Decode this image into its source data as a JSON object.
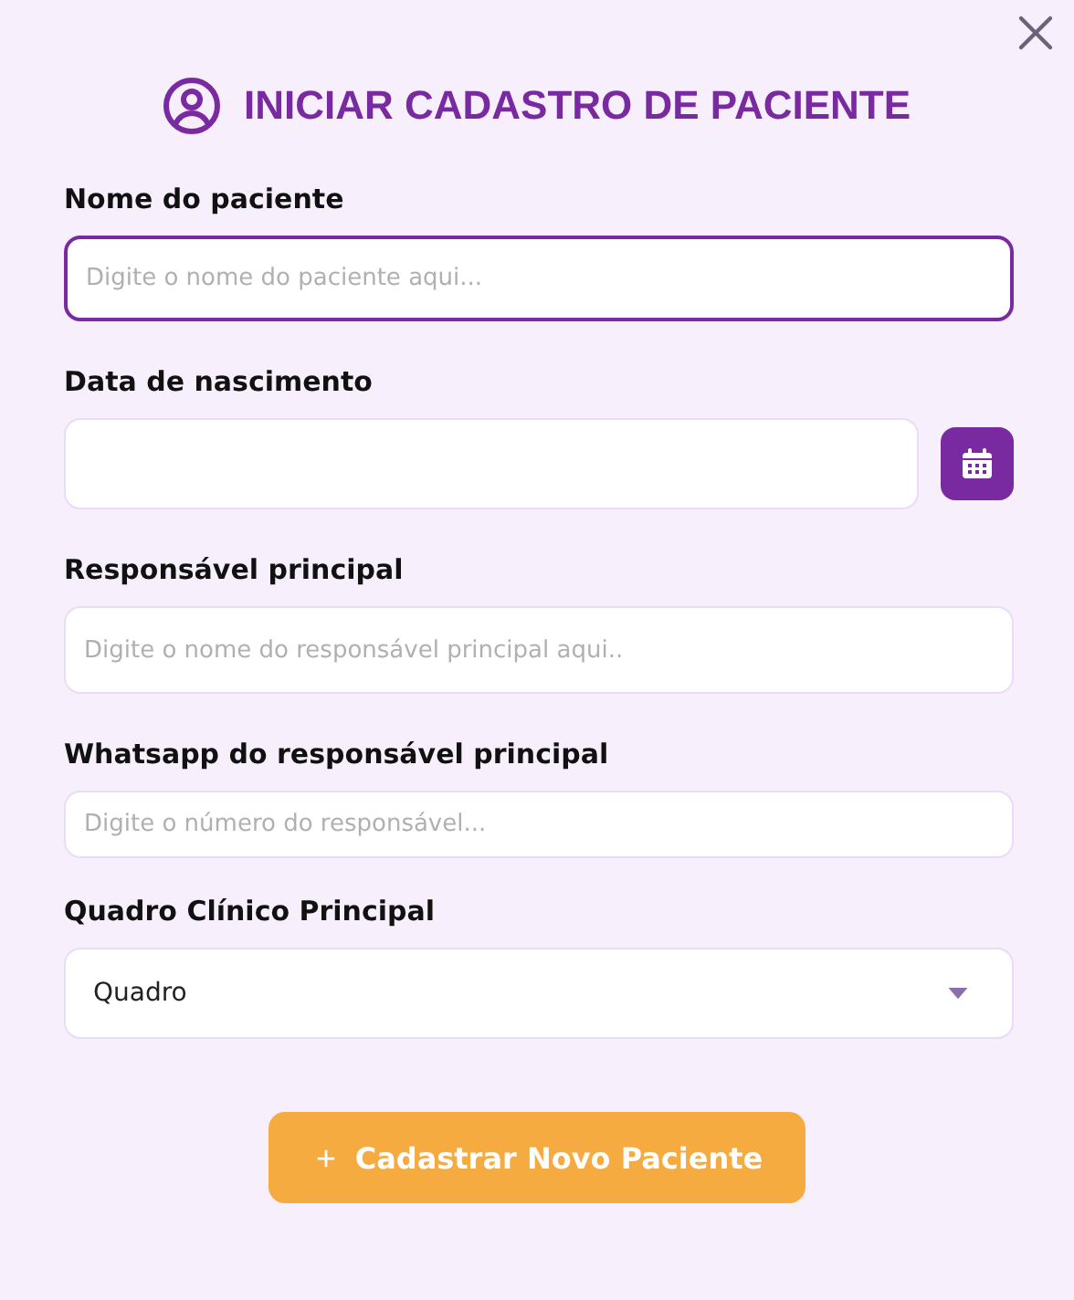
{
  "title": "INICIAR CADASTRO DE PACIENTE",
  "fields": [
    {
      "kind": "text",
      "label": "Nome do paciente",
      "placeholder": "Digite o nome do paciente aqui...",
      "focused": true
    },
    {
      "kind": "date",
      "label": "Data de nascimento",
      "focused": false
    },
    {
      "kind": "text",
      "label": "Responsável principal",
      "placeholder": "Digite o nome do responsável principal aqui..",
      "focused": false
    },
    {
      "kind": "text",
      "label": "Whatsapp do responsável principal",
      "placeholder": "Digite o número do responsável...",
      "focused": false
    },
    {
      "kind": "select",
      "label": "Quadro Clínico Principal",
      "value": "Quadro",
      "focused": false
    }
  ],
  "submit": {
    "label": "Cadastrar Novo Paciente"
  }
}
